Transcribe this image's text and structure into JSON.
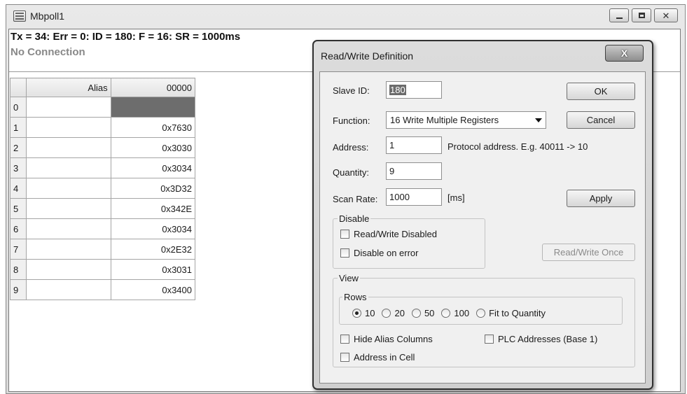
{
  "window": {
    "title": "Mbpoll1",
    "icon": "modbus-app-icon"
  },
  "status": {
    "summary": "Tx = 34: Err = 0: ID = 180: F = 16: SR = 1000ms",
    "connection": "No Connection"
  },
  "grid": {
    "headers": {
      "alias": "Alias",
      "value": "00000"
    },
    "rows": [
      {
        "index": "0",
        "alias": "",
        "value": ""
      },
      {
        "index": "1",
        "alias": "",
        "value": "0x7630"
      },
      {
        "index": "2",
        "alias": "",
        "value": "0x3030"
      },
      {
        "index": "3",
        "alias": "",
        "value": "0x3034"
      },
      {
        "index": "4",
        "alias": "",
        "value": "0x3D32"
      },
      {
        "index": "5",
        "alias": "",
        "value": "0x342E"
      },
      {
        "index": "6",
        "alias": "",
        "value": "0x3034"
      },
      {
        "index": "7",
        "alias": "",
        "value": "0x2E32"
      },
      {
        "index": "8",
        "alias": "",
        "value": "0x3031"
      },
      {
        "index": "9",
        "alias": "",
        "value": "0x3400"
      }
    ]
  },
  "dialog": {
    "title": "Read/Write Definition",
    "close_glyph": "X",
    "slave_id": {
      "label": "Slave ID:",
      "value": "180"
    },
    "function": {
      "label": "Function:",
      "value": "16 Write Multiple Registers"
    },
    "address": {
      "label": "Address:",
      "value": "1",
      "hint": "Protocol address. E.g. 40011 -> 10"
    },
    "quantity": {
      "label": "Quantity:",
      "value": "9"
    },
    "scan_rate": {
      "label": "Scan Rate:",
      "value": "1000",
      "unit": "[ms]"
    },
    "buttons": {
      "ok": "OK",
      "cancel": "Cancel",
      "apply": "Apply",
      "read_write_once": "Read/Write Once"
    },
    "disable": {
      "title": "Disable",
      "read_write_disabled": "Read/Write Disabled",
      "disable_on_error": "Disable on error"
    },
    "view": {
      "title": "View",
      "rows_title": "Rows",
      "row_options": [
        "10",
        "20",
        "50",
        "100",
        "Fit to Quantity"
      ],
      "selected_rows": "10",
      "hide_alias": "Hide Alias Columns",
      "plc_addresses": "PLC Addresses (Base 1)",
      "address_in_cell": "Address in Cell"
    }
  }
}
